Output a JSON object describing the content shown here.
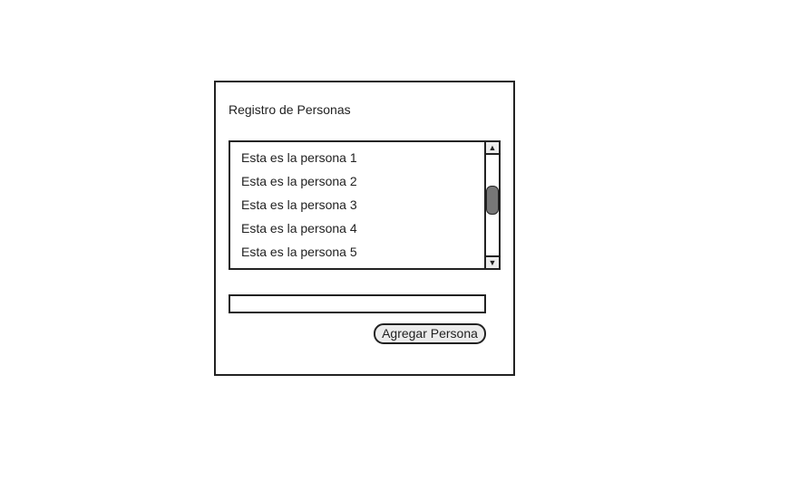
{
  "panel": {
    "title": "Registro de Personas",
    "list": {
      "items": [
        "Esta es la persona 1",
        "Esta es la persona 2",
        "Esta es la persona 3",
        "Esta es la persona 4",
        "Esta es la persona 5"
      ],
      "scroll_up_icon": "▲",
      "scroll_down_icon": "▼"
    },
    "name_input": {
      "value": "",
      "placeholder": ""
    },
    "add_button_label": "Agregar Persona"
  }
}
